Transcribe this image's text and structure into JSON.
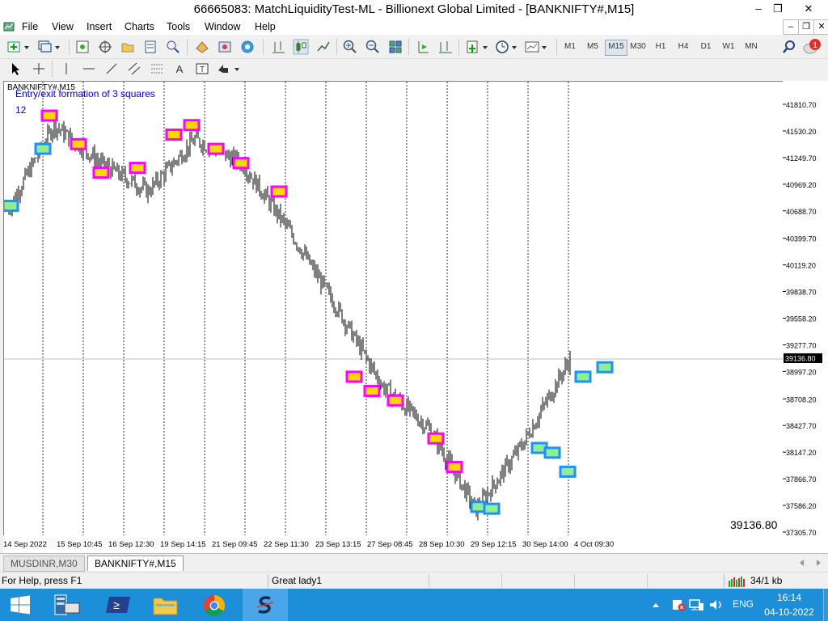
{
  "window": {
    "title": "66665083: MatchLiquidityTest-ML - Billionext Global Limited - [BANKNIFTY#,M15]",
    "controls": [
      "–",
      "❐",
      "✕"
    ]
  },
  "menu": {
    "items": [
      "File",
      "View",
      "Insert",
      "Charts",
      "Tools",
      "Window",
      "Help"
    ],
    "mdi_controls": [
      "–",
      "❐",
      "✕"
    ]
  },
  "toolbar": {
    "timeframes": [
      "M1",
      "M5",
      "M15",
      "M30",
      "H1",
      "H4",
      "D1",
      "W1",
      "MN"
    ],
    "active_timeframe": "M15",
    "notification_count": "1"
  },
  "chart": {
    "symbol_label": "BANKNIFTY#,M15",
    "indicator_label": "Entry/exit formation of 3 squares",
    "indicator_value": "12",
    "current_price": "39136.80",
    "price_display": "39136.80",
    "price_ticks": [
      "41810.70",
      "41530.20",
      "41249.70",
      "40969.20",
      "40688.70",
      "40399.70",
      "40119.20",
      "39838.70",
      "39558.20",
      "39277.70",
      "38997.20",
      "38708.20",
      "38427.70",
      "38147.20",
      "37866.70",
      "37586.20",
      "37305.70"
    ],
    "time_ticks": [
      "14 Sep 2022",
      "15 Sep 10:45",
      "16 Sep 12:30",
      "19 Sep 14:15",
      "21 Sep 09:45",
      "22 Sep 11:30",
      "23 Sep 13:15",
      "27 Sep 08:45",
      "28 Sep 10:30",
      "29 Sep 12:15",
      "30 Sep 14:00",
      "4 Oct 09:30"
    ],
    "colors": {
      "bar": "#000000",
      "sell_square_border": "#ff00ff",
      "buy_square_border": "#1e90ff",
      "square_fill_sell": "#ffd700",
      "square_fill_buy": "#90ee90",
      "indicator_text": "#0000cc"
    }
  },
  "chart_data": {
    "type": "line",
    "title": "BANKNIFTY#,M15",
    "xlabel": "",
    "ylabel": "",
    "x": [
      "14 Sep 2022",
      "15 Sep 10:45",
      "16 Sep 12:30",
      "19 Sep 14:15",
      "21 Sep 09:45",
      "22 Sep 11:30",
      "23 Sep 13:15",
      "27 Sep 08:45",
      "28 Sep 10:30",
      "29 Sep 12:15",
      "30 Sep 14:00",
      "4 Oct 09:30"
    ],
    "ylim": [
      37305.7,
      41810.7
    ],
    "series": [
      {
        "values": [
          40700,
          41600,
          41200,
          40900,
          41450,
          41200,
          40500,
          39700,
          38850,
          38400,
          37550,
          38250,
          39136.8
        ]
      }
    ],
    "markers_sell": [
      41700,
      41400,
      41100,
      41150,
      41500,
      41600,
      41350,
      41200,
      40900,
      38950,
      38800,
      38700,
      38300,
      38000
    ],
    "markers_buy": [
      40750,
      41350,
      37580,
      37560,
      38200,
      38150,
      37950,
      38950,
      39050
    ]
  },
  "tabs": [
    "MUSDINR,M30",
    "BANKNIFTY#,M15"
  ],
  "active_tab": "BANKNIFTY#,M15",
  "status": {
    "help": "For Help, press F1",
    "profile": "Great lady1",
    "traffic": "34/1 kb"
  },
  "taskbar": {
    "lang": "ENG",
    "time": "16:14",
    "date": "04-10-2022"
  }
}
